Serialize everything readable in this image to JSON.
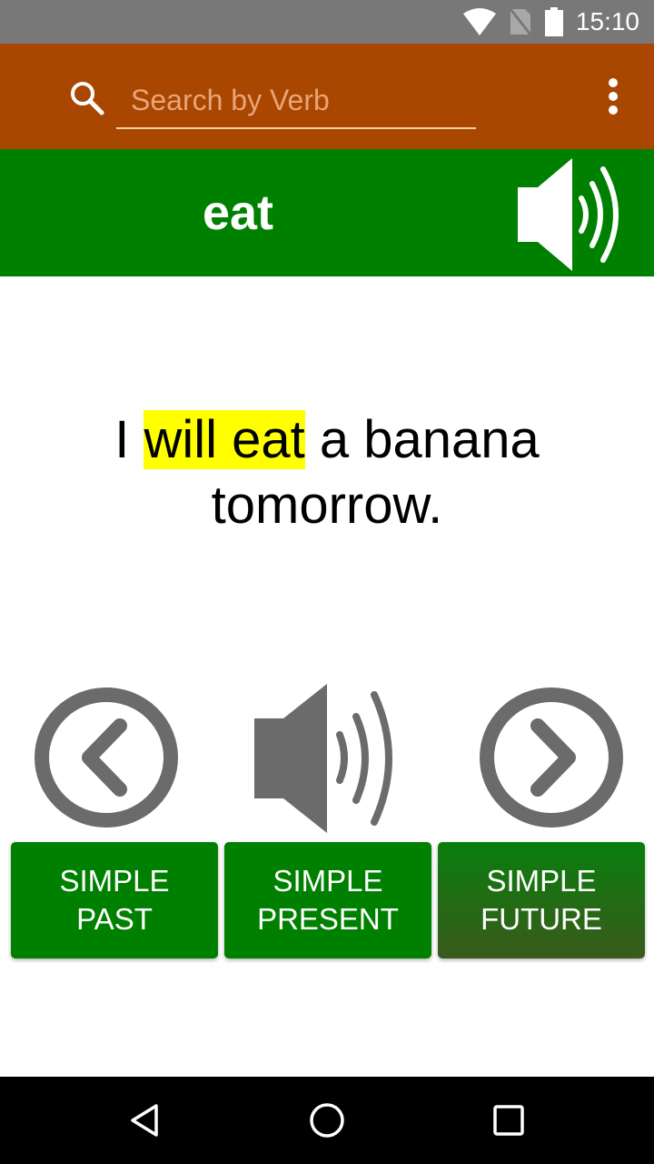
{
  "status_bar": {
    "time": "15:10",
    "icons": [
      "wifi-icon",
      "no-sim-icon",
      "battery-icon"
    ]
  },
  "toolbar": {
    "search_placeholder": "Search by Verb",
    "search_value": "",
    "search_icon": "search-icon",
    "menu_icon": "overflow-menu-icon"
  },
  "verb_bar": {
    "verb": "eat",
    "speaker_icon": "speaker-icon"
  },
  "sentence": {
    "before": "I ",
    "highlight": "will eat",
    "after": " a banana tomorrow."
  },
  "controls": {
    "prev_icon": "chevron-left-circle-icon",
    "speaker_icon": "speaker-icon",
    "next_icon": "chevron-right-circle-icon"
  },
  "tenses": [
    {
      "line1": "SIMPLE",
      "line2": "PAST",
      "selected": false
    },
    {
      "line1": "SIMPLE",
      "line2": "PRESENT",
      "selected": false
    },
    {
      "line1": "SIMPLE",
      "line2": "FUTURE",
      "selected": true
    }
  ],
  "colors": {
    "toolbar": "#a94600",
    "verb_bar": "#008000",
    "highlight": "#ffff00",
    "icon_gray": "#6b6b6b"
  },
  "nav_bar": {
    "buttons": [
      "back-icon",
      "home-icon",
      "recents-icon"
    ]
  }
}
